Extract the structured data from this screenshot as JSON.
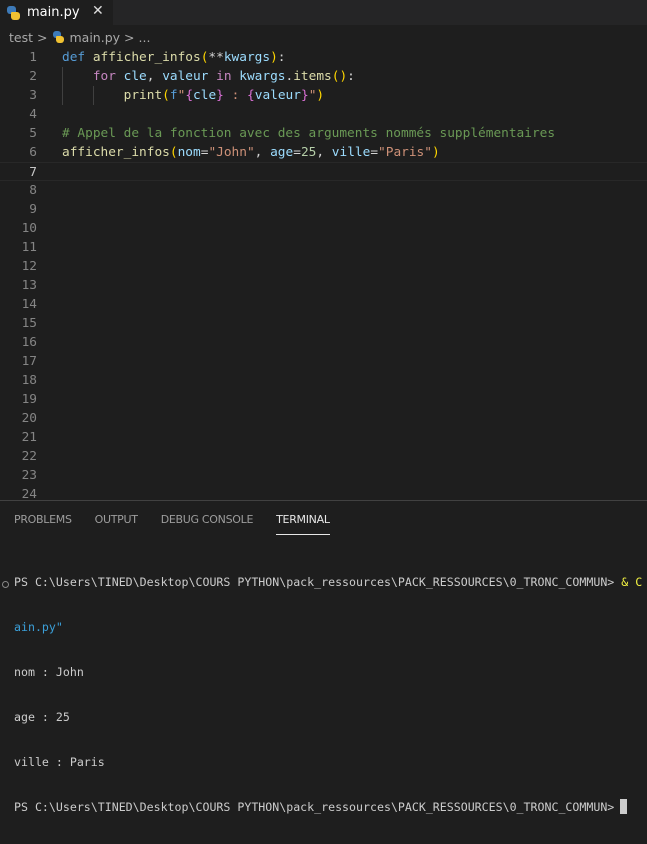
{
  "tab": {
    "label": "main.py",
    "close": "✕",
    "icon": "python-icon"
  },
  "breadcrumb": {
    "folder": "test",
    "sep": ">",
    "file": "main.py",
    "more": "..."
  },
  "editor": {
    "active_line": 7,
    "line_count": 24,
    "lines": [
      [
        {
          "t": "def ",
          "c": "#569cd6"
        },
        {
          "t": "afficher_infos",
          "c": "#dcdcaa"
        },
        {
          "t": "(",
          "c": "#ffd700"
        },
        {
          "t": "**",
          "c": "#d4d4d4"
        },
        {
          "t": "kwargs",
          "c": "#9cdcfe"
        },
        {
          "t": ")",
          "c": "#ffd700"
        },
        {
          "t": ":",
          "c": "#d4d4d4"
        }
      ],
      [
        {
          "t": "    for ",
          "c": "#c586c0"
        },
        {
          "t": "cle",
          "c": "#9cdcfe"
        },
        {
          "t": ", ",
          "c": "#d4d4d4"
        },
        {
          "t": "valeur ",
          "c": "#9cdcfe"
        },
        {
          "t": "in ",
          "c": "#c586c0"
        },
        {
          "t": "kwargs",
          "c": "#9cdcfe"
        },
        {
          "t": ".",
          "c": "#d4d4d4"
        },
        {
          "t": "items",
          "c": "#dcdcaa"
        },
        {
          "t": "()",
          "c": "#ffd700"
        },
        {
          "t": ":",
          "c": "#d4d4d4"
        }
      ],
      [
        {
          "t": "        print",
          "c": "#dcdcaa"
        },
        {
          "t": "(",
          "c": "#ffd700"
        },
        {
          "t": "f",
          "c": "#569cd6"
        },
        {
          "t": "\"",
          "c": "#ce9178"
        },
        {
          "t": "{",
          "c": "#da70d6"
        },
        {
          "t": "cle",
          "c": "#9cdcfe"
        },
        {
          "t": "}",
          "c": "#da70d6"
        },
        {
          "t": " : ",
          "c": "#ce9178"
        },
        {
          "t": "{",
          "c": "#da70d6"
        },
        {
          "t": "valeur",
          "c": "#9cdcfe"
        },
        {
          "t": "}",
          "c": "#da70d6"
        },
        {
          "t": "\"",
          "c": "#ce9178"
        },
        {
          "t": ")",
          "c": "#ffd700"
        }
      ],
      [],
      [
        {
          "t": "# Appel de la fonction avec des arguments nommés supplémentaires",
          "c": "#6a9955"
        }
      ],
      [
        {
          "t": "afficher_infos",
          "c": "#dcdcaa"
        },
        {
          "t": "(",
          "c": "#ffd700"
        },
        {
          "t": "nom",
          "c": "#9cdcfe"
        },
        {
          "t": "=",
          "c": "#d4d4d4"
        },
        {
          "t": "\"John\"",
          "c": "#ce9178"
        },
        {
          "t": ", ",
          "c": "#d4d4d4"
        },
        {
          "t": "age",
          "c": "#9cdcfe"
        },
        {
          "t": "=",
          "c": "#d4d4d4"
        },
        {
          "t": "25",
          "c": "#b5cea8"
        },
        {
          "t": ", ",
          "c": "#d4d4d4"
        },
        {
          "t": "ville",
          "c": "#9cdcfe"
        },
        {
          "t": "=",
          "c": "#d4d4d4"
        },
        {
          "t": "\"Paris\"",
          "c": "#ce9178"
        },
        {
          "t": ")",
          "c": "#ffd700"
        }
      ]
    ]
  },
  "panel": {
    "tabs": [
      "PROBLEMS",
      "OUTPUT",
      "DEBUG CONSOLE",
      "TERMINAL"
    ],
    "active_tab": "TERMINAL",
    "terminal": {
      "line1": "PS C:\\Users\\TINED\\Desktop\\COURS PYTHON\\pack_ressources\\PACK_RESSOURCES\\0_TRONC_COMMUN> ",
      "line1_cmd": "& C",
      "line2": "ain.py\"",
      "out1": "nom : John",
      "out2": "age : 25",
      "out3": "ville : Paris",
      "prompt": "PS C:\\Users\\TINED\\Desktop\\COURS PYTHON\\pack_ressources\\PACK_RESSOURCES\\0_TRONC_COMMUN>"
    }
  }
}
